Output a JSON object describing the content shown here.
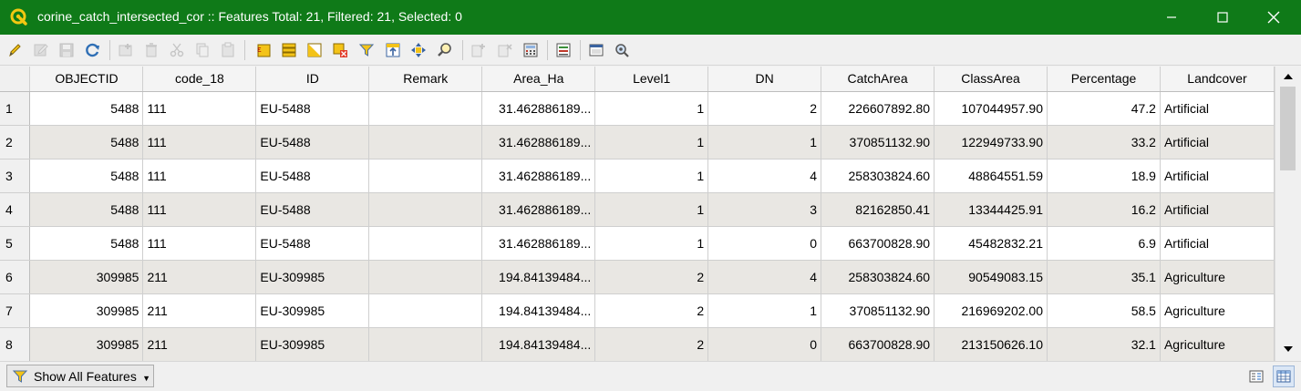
{
  "window": {
    "title": "corine_catch_intersected_cor :: Features Total: 21, Filtered: 21, Selected: 0",
    "accent_color": "#0f7a18"
  },
  "toolbar": {
    "buttons": [
      {
        "icon": "pencil-icon",
        "tooltip": "Toggle editing mode",
        "enabled": true
      },
      {
        "icon": "multi-edit-icon",
        "tooltip": "Toggle multi edit mode",
        "enabled": false
      },
      {
        "icon": "save-icon",
        "tooltip": "Save edits",
        "enabled": false
      },
      {
        "icon": "reload-icon",
        "tooltip": "Reload the table",
        "enabled": true
      },
      {
        "icon": "add-feature-icon",
        "tooltip": "Add feature",
        "enabled": false
      },
      {
        "icon": "delete-icon",
        "tooltip": "Delete selected features",
        "enabled": false
      },
      {
        "icon": "cut-icon",
        "tooltip": "Cut selected rows",
        "enabled": false
      },
      {
        "icon": "copy-icon",
        "tooltip": "Copy selected rows",
        "enabled": false
      },
      {
        "icon": "paste-icon",
        "tooltip": "Paste features",
        "enabled": false
      },
      {
        "icon": "select-expression-icon",
        "tooltip": "Select features using an expression",
        "enabled": true
      },
      {
        "icon": "select-all-icon",
        "tooltip": "Select all",
        "enabled": true
      },
      {
        "icon": "invert-selection-icon",
        "tooltip": "Invert selection",
        "enabled": true
      },
      {
        "icon": "deselect-icon",
        "tooltip": "Deselect all",
        "enabled": true
      },
      {
        "icon": "filter-icon",
        "tooltip": "Filter/Select features using form",
        "enabled": true
      },
      {
        "icon": "move-to-top-icon",
        "tooltip": "Move selection to top",
        "enabled": true
      },
      {
        "icon": "pan-to-selection-icon",
        "tooltip": "Pan map to selected rows",
        "enabled": true
      },
      {
        "icon": "zoom-to-selection-icon",
        "tooltip": "Zoom map to selected rows",
        "enabled": true
      },
      {
        "icon": "new-field-icon",
        "tooltip": "New field",
        "enabled": false
      },
      {
        "icon": "delete-field-icon",
        "tooltip": "Delete field",
        "enabled": false
      },
      {
        "icon": "field-calculator-icon",
        "tooltip": "Open field calculator",
        "enabled": true
      },
      {
        "icon": "conditional-formatting-icon",
        "tooltip": "Conditional formatting",
        "enabled": true
      },
      {
        "icon": "dock-icon",
        "tooltip": "Dock attribute table",
        "enabled": true
      },
      {
        "icon": "actions-icon",
        "tooltip": "Actions",
        "enabled": true
      }
    ]
  },
  "table": {
    "columns": [
      "OBJECTID",
      "code_18",
      "ID",
      "Remark",
      "Area_Ha",
      "Level1",
      "DN",
      "CatchArea",
      "ClassArea",
      "Percentage",
      "Landcover"
    ],
    "rows": [
      {
        "n": "1",
        "cells": [
          "5488",
          "111",
          "EU-5488",
          "",
          "31.462886189...",
          "1",
          "2",
          "226607892.80",
          "107044957.90",
          "47.2",
          "Artificial"
        ]
      },
      {
        "n": "2",
        "cells": [
          "5488",
          "111",
          "EU-5488",
          "",
          "31.462886189...",
          "1",
          "1",
          "370851132.90",
          "122949733.90",
          "33.2",
          "Artificial"
        ]
      },
      {
        "n": "3",
        "cells": [
          "5488",
          "111",
          "EU-5488",
          "",
          "31.462886189...",
          "1",
          "4",
          "258303824.60",
          "48864551.59",
          "18.9",
          "Artificial"
        ]
      },
      {
        "n": "4",
        "cells": [
          "5488",
          "111",
          "EU-5488",
          "",
          "31.462886189...",
          "1",
          "3",
          "82162850.41",
          "13344425.91",
          "16.2",
          "Artificial"
        ]
      },
      {
        "n": "5",
        "cells": [
          "5488",
          "111",
          "EU-5488",
          "",
          "31.462886189...",
          "1",
          "0",
          "663700828.90",
          "45482832.21",
          "6.9",
          "Artificial"
        ]
      },
      {
        "n": "6",
        "cells": [
          "309985",
          "211",
          "EU-309985",
          "",
          "194.84139484...",
          "2",
          "4",
          "258303824.60",
          "90549083.15",
          "35.1",
          "Agriculture"
        ]
      },
      {
        "n": "7",
        "cells": [
          "309985",
          "211",
          "EU-309985",
          "",
          "194.84139484...",
          "2",
          "1",
          "370851132.90",
          "216969202.00",
          "58.5",
          "Agriculture"
        ]
      },
      {
        "n": "8",
        "cells": [
          "309985",
          "211",
          "EU-309985",
          "",
          "194.84139484...",
          "2",
          "0",
          "663700828.90",
          "213150626.10",
          "32.1",
          "Agriculture"
        ]
      }
    ]
  },
  "status": {
    "show_all_label": "Show All Features"
  }
}
